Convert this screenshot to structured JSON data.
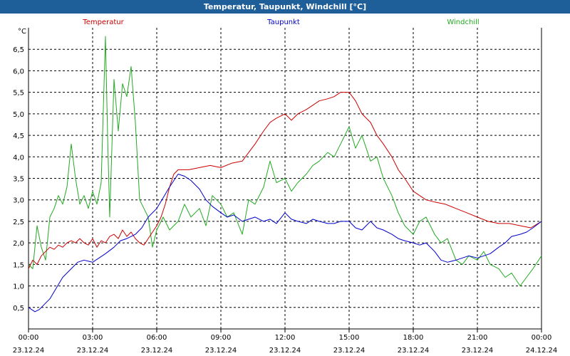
{
  "window": {
    "title": "Temperatur, Taupunkt, Windchill [°C]"
  },
  "chart_data": {
    "type": "line",
    "title": "Temperatur, Taupunkt, Windchill [°C]",
    "ylabel": "°C",
    "ylim": [
      0.0,
      7.0
    ],
    "y_ticks": [
      "0,5",
      "1,0",
      "1,5",
      "2,0",
      "2,5",
      "3,0",
      "3,5",
      "4,0",
      "4,5",
      "5,0",
      "5,5",
      "6,0",
      "6,5"
    ],
    "x_ticks": [
      {
        "time": "00:00",
        "date": "23.12.24"
      },
      {
        "time": "03:00",
        "date": "23.12.24"
      },
      {
        "time": "06:00",
        "date": "23.12.24"
      },
      {
        "time": "09:00",
        "date": "23.12.24"
      },
      {
        "time": "12:00",
        "date": "23.12.24"
      },
      {
        "time": "15:00",
        "date": "23.12.24"
      },
      {
        "time": "18:00",
        "date": "23.12.24"
      },
      {
        "time": "21:00",
        "date": "23.12.24"
      },
      {
        "time": "00:00",
        "date": "24.12.24"
      }
    ],
    "x_range_hours": [
      0,
      24
    ],
    "grid": true,
    "legend_placement": "top",
    "series": [
      {
        "name": "Temperatur",
        "color": "#cc0000",
        "x": [
          0,
          0.2,
          0.4,
          0.6,
          0.8,
          1.0,
          1.2,
          1.4,
          1.6,
          1.8,
          2.0,
          2.2,
          2.4,
          2.6,
          2.8,
          3.0,
          3.2,
          3.4,
          3.6,
          3.8,
          4.0,
          4.2,
          4.4,
          4.6,
          4.8,
          5.0,
          5.2,
          5.4,
          5.6,
          5.8,
          6.0,
          6.2,
          6.4,
          6.6,
          6.8,
          7.0,
          7.5,
          8.0,
          8.5,
          9.0,
          9.5,
          10.0,
          10.3,
          10.6,
          11.0,
          11.3,
          11.6,
          12.0,
          12.3,
          12.6,
          13.0,
          13.3,
          13.6,
          14.0,
          14.3,
          14.6,
          15.0,
          15.3,
          15.6,
          16.0,
          16.3,
          16.6,
          17.0,
          17.3,
          17.6,
          18.0,
          18.3,
          18.6,
          19.0,
          19.5,
          20.0,
          20.5,
          21.0,
          21.5,
          22.0,
          22.5,
          23.0,
          23.5,
          24.0
        ],
        "y": [
          1.4,
          1.6,
          1.5,
          1.7,
          1.8,
          1.9,
          1.85,
          1.95,
          1.9,
          2.0,
          2.05,
          2.0,
          2.1,
          2.0,
          1.95,
          2.1,
          1.9,
          2.05,
          2.0,
          2.15,
          2.2,
          2.1,
          2.3,
          2.15,
          2.25,
          2.1,
          2.0,
          1.95,
          2.1,
          2.25,
          2.4,
          2.6,
          2.9,
          3.3,
          3.6,
          3.7,
          3.7,
          3.75,
          3.8,
          3.75,
          3.85,
          3.9,
          4.1,
          4.3,
          4.6,
          4.8,
          4.9,
          5.0,
          4.85,
          5.0,
          5.1,
          5.2,
          5.3,
          5.35,
          5.4,
          5.5,
          5.5,
          5.3,
          5.0,
          4.8,
          4.5,
          4.3,
          4.0,
          3.7,
          3.5,
          3.2,
          3.1,
          3.0,
          2.95,
          2.9,
          2.8,
          2.7,
          2.6,
          2.5,
          2.45,
          2.45,
          2.4,
          2.35,
          2.5
        ]
      },
      {
        "name": "Taupunkt",
        "color": "#0000cc",
        "x": [
          0,
          0.3,
          0.5,
          0.8,
          1.0,
          1.3,
          1.6,
          2.0,
          2.3,
          2.6,
          3.0,
          3.3,
          3.6,
          4.0,
          4.3,
          4.6,
          5.0,
          5.3,
          5.6,
          6.0,
          6.3,
          6.6,
          7.0,
          7.3,
          7.6,
          8.0,
          8.3,
          8.6,
          9.0,
          9.3,
          9.6,
          10.0,
          10.3,
          10.6,
          11.0,
          11.3,
          11.6,
          12.0,
          12.3,
          12.6,
          13.0,
          13.3,
          13.6,
          14.0,
          14.3,
          14.6,
          15.0,
          15.3,
          15.6,
          16.0,
          16.3,
          16.6,
          17.0,
          17.3,
          17.6,
          18.0,
          18.3,
          18.6,
          19.0,
          19.3,
          19.6,
          20.0,
          20.3,
          20.6,
          21.0,
          21.3,
          21.6,
          22.0,
          22.3,
          22.6,
          23.0,
          23.3,
          23.6,
          24.0
        ],
        "y": [
          0.5,
          0.4,
          0.45,
          0.6,
          0.7,
          0.95,
          1.2,
          1.4,
          1.55,
          1.6,
          1.55,
          1.65,
          1.75,
          1.9,
          2.05,
          2.1,
          2.2,
          2.35,
          2.6,
          2.8,
          3.05,
          3.3,
          3.6,
          3.55,
          3.45,
          3.25,
          3.0,
          2.85,
          2.7,
          2.6,
          2.65,
          2.5,
          2.55,
          2.6,
          2.5,
          2.55,
          2.45,
          2.7,
          2.55,
          2.5,
          2.45,
          2.55,
          2.5,
          2.45,
          2.45,
          2.5,
          2.5,
          2.35,
          2.3,
          2.5,
          2.35,
          2.3,
          2.2,
          2.1,
          2.05,
          2.0,
          1.95,
          2.0,
          1.8,
          1.6,
          1.55,
          1.6,
          1.65,
          1.7,
          1.65,
          1.7,
          1.75,
          1.9,
          2.0,
          2.15,
          2.2,
          2.25,
          2.35,
          2.5
        ]
      },
      {
        "name": "Windchill",
        "color": "#22aa22",
        "x": [
          0,
          0.2,
          0.4,
          0.6,
          0.8,
          1.0,
          1.2,
          1.4,
          1.6,
          1.8,
          2.0,
          2.2,
          2.4,
          2.6,
          2.8,
          3.0,
          3.2,
          3.4,
          3.6,
          3.7,
          3.8,
          4.0,
          4.2,
          4.4,
          4.6,
          4.8,
          5.0,
          5.2,
          5.4,
          5.6,
          5.8,
          6.0,
          6.3,
          6.6,
          7.0,
          7.3,
          7.6,
          8.0,
          8.3,
          8.6,
          9.0,
          9.3,
          9.6,
          10.0,
          10.3,
          10.6,
          11.0,
          11.3,
          11.6,
          12.0,
          12.3,
          12.6,
          13.0,
          13.3,
          13.6,
          14.0,
          14.3,
          14.6,
          15.0,
          15.3,
          15.6,
          16.0,
          16.3,
          16.6,
          17.0,
          17.3,
          17.6,
          18.0,
          18.3,
          18.6,
          19.0,
          19.3,
          19.6,
          20.0,
          20.3,
          20.6,
          21.0,
          21.3,
          21.6,
          22.0,
          22.3,
          22.6,
          23.0,
          23.3,
          23.6,
          24.0
        ],
        "y": [
          1.5,
          1.4,
          2.4,
          1.9,
          1.6,
          2.6,
          2.8,
          3.1,
          2.9,
          3.3,
          4.3,
          3.5,
          2.9,
          3.1,
          2.8,
          3.2,
          2.9,
          3.4,
          6.8,
          4.5,
          2.6,
          5.8,
          4.6,
          5.7,
          5.4,
          6.1,
          4.8,
          3.0,
          2.8,
          2.6,
          1.9,
          2.3,
          2.6,
          2.3,
          2.5,
          2.9,
          2.6,
          2.8,
          2.4,
          3.1,
          2.9,
          2.6,
          2.7,
          2.2,
          3.0,
          2.9,
          3.3,
          3.9,
          3.4,
          3.5,
          3.2,
          3.4,
          3.6,
          3.8,
          3.9,
          4.1,
          4.0,
          4.3,
          4.7,
          4.2,
          4.5,
          3.9,
          4.0,
          3.5,
          3.1,
          2.7,
          2.4,
          2.2,
          2.5,
          2.6,
          2.2,
          2.0,
          2.1,
          1.6,
          1.5,
          1.7,
          1.6,
          1.8,
          1.5,
          1.4,
          1.2,
          1.3,
          1.0,
          1.2,
          1.4,
          1.7
        ]
      }
    ]
  }
}
